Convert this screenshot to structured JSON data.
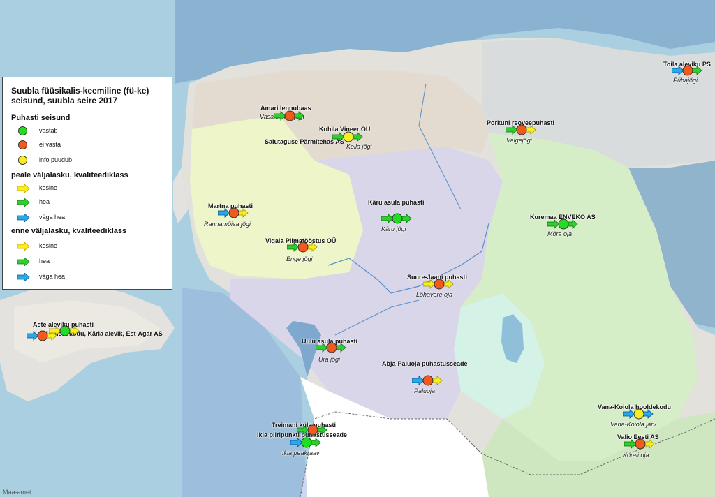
{
  "legend": {
    "title": "Suubla füüsikalis-keemiline (fü-ke) seisund,  suubla seire 2017",
    "status_heading": "Puhasti seisund",
    "status": [
      {
        "label": "vastab",
        "color": "#22dd22"
      },
      {
        "label": "ei vasta",
        "color": "#f05a1e"
      },
      {
        "label": "info puudub",
        "color": "#f7ee22"
      }
    ],
    "after_heading": "peale väljalasku, kvaliteediklass",
    "after": [
      {
        "label": "kesine",
        "color": "#f7ee22"
      },
      {
        "label": "hea",
        "color": "#33cc33"
      },
      {
        "label": "väga hea",
        "color": "#2aa8e8"
      }
    ],
    "before_heading": "enne väljalasku, kvaliteediklass",
    "before": [
      {
        "label": "kesine",
        "color": "#f7ee22"
      },
      {
        "label": "hea",
        "color": "#33cc33"
      },
      {
        "label": "väga hea",
        "color": "#2aa8e8"
      }
    ]
  },
  "sites": {
    "toila": {
      "name": "Toila aleviku PS",
      "river": "Pühajõgi",
      "status": "#f05a1e",
      "before": "#2aa8e8",
      "after": "#33cc33"
    },
    "amari": {
      "name": "Ämari lennubaas",
      "river": "Vasalemma jõgi",
      "status": "#f05a1e",
      "before": "#33cc33",
      "after": "#33cc33"
    },
    "kohila": {
      "name": "Kohila Vineer OÜ",
      "river": "Keila jõgi",
      "status": "#f7ee22",
      "before": "#33cc33",
      "after": "#33cc33"
    },
    "salutaguse": {
      "name": "Salutaguse Pärmitehas AS"
    },
    "porkuni": {
      "name": "Porkuni reoveepuhasti",
      "river": "Valgejõgi",
      "status": "#f05a1e",
      "before": "#33cc33",
      "after": "#f7ee22"
    },
    "martna": {
      "name": "Martna puhasti",
      "river": "Rannamõisa jõgi",
      "status": "#f05a1e",
      "before": "#2aa8e8",
      "after": "#f7ee22"
    },
    "karu": {
      "name": "Käru asula puhasti",
      "river": "Käru jõgi",
      "status": "#22dd22",
      "before": "#33cc33",
      "after": "#33cc33"
    },
    "kuremaa": {
      "name": "Kuremaa ENVEKO AS",
      "river": "Mõra oja",
      "status": "#22dd22",
      "before": "#33cc33",
      "after": "#33cc33"
    },
    "vigala": {
      "name": "Vigala Piimatööstus OÜ",
      "river": "Enge jõgi",
      "status": "#f05a1e",
      "before": "#33cc33",
      "after": "#f7ee22"
    },
    "suurejaani": {
      "name": "Suure-Jaani puhasti",
      "river": "Lõhavere oja",
      "status": "#f05a1e",
      "before": "#f7ee22",
      "after": "#f7ee22"
    },
    "aste": {
      "name": "Aste aleviku puhasti",
      "status": "#f05a1e",
      "before": "#2aa8e8",
      "after": "#f7ee22"
    },
    "someta": {
      "name": "Sõmeta kodu, Kärla alevik, Est-Agar AS",
      "status": "#22dd22",
      "before": "#f7ee22",
      "after": "#f7ee22"
    },
    "uulu": {
      "name": "Uulu asula puhasti",
      "river": "Ura jõgi",
      "status": "#f05a1e",
      "before": "#33cc33",
      "after": "#33cc33"
    },
    "abja": {
      "name": "Abja-Paluoja puhastusseade",
      "river": "Paluoja",
      "status": "#f05a1e",
      "before": "#2aa8e8",
      "after": "#f7ee22"
    },
    "vanakoiola": {
      "name": "Vana-Koiola hooldekodu",
      "river": "Vana-Koiola järv",
      "status": "#f7ee22",
      "before": "#2aa8e8",
      "after": "#2aa8e8"
    },
    "valio": {
      "name": "Valio Eesti AS",
      "river": "Koreli oja",
      "status": "#f05a1e",
      "before": "#33cc33",
      "after": "#f7ee22"
    },
    "treimani": {
      "name": "Treimani küla puhasti",
      "status": "#f05a1e",
      "before": "#33cc33",
      "after": "#33cc33"
    },
    "ikla": {
      "name": "Ikla piiripunkti puhastusseade",
      "river": "Ikla peakraav",
      "status": "#22dd22",
      "before": "#2aa8e8",
      "after": "#33cc33"
    }
  },
  "credit": "Maa-amet"
}
